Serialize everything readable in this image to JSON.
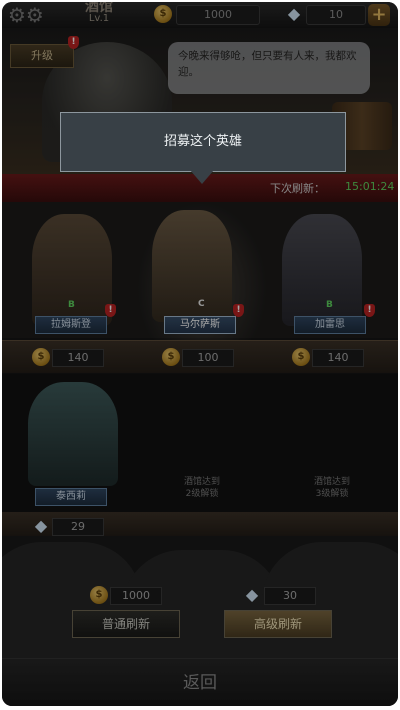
{
  "header": {
    "title": "酒馆",
    "level": "Lv.1",
    "gold": "1000",
    "gems": "10",
    "gold_icon": "gold-coin-icon",
    "gem_icon": "diamond-icon",
    "plus_icon": "plus-icon",
    "settings_icon": "gears-icon"
  },
  "scene": {
    "upgrade_label": "升级",
    "badge": "!",
    "speech": "今晚来得够呛，但只要有人来，我都欢迎。"
  },
  "tooltip": {
    "text": "招募这个英雄"
  },
  "refresh_timer": {
    "label": "下次刷新：",
    "time": "15:01:24"
  },
  "heroes_row1": [
    {
      "name": "拉姆斯登",
      "grade": "B",
      "price": "140",
      "badge": "!"
    },
    {
      "name": "马尔萨斯",
      "grade": "C",
      "price": "100",
      "badge": "!"
    },
    {
      "name": "加雷思",
      "grade": "B",
      "price": "140",
      "badge": "!"
    }
  ],
  "heroes_row2": [
    {
      "name": "泰西莉",
      "price": "29"
    },
    {
      "locked_text_1": "酒馆达到",
      "locked_text_2": "2级解锁"
    },
    {
      "locked_text_1": "酒馆达到",
      "locked_text_2": "3级解锁"
    }
  ],
  "refresh": {
    "normal_cost": "1000",
    "normal_label": "普通刷新",
    "premium_cost": "30",
    "premium_label": "高级刷新"
  },
  "footer": {
    "back_label": "返回"
  },
  "colors": {
    "timer": "#5fd35f",
    "badge": "#bb2222",
    "tooltip_bg": "#384046"
  }
}
